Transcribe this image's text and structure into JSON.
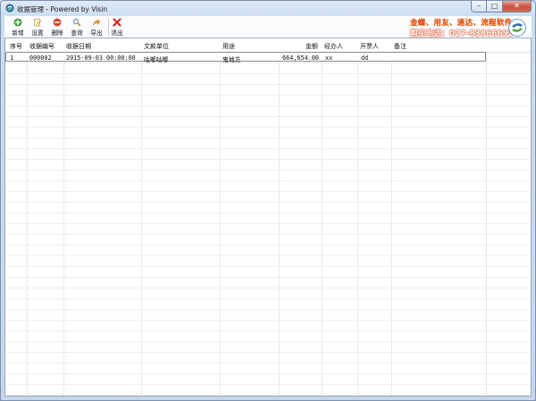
{
  "window": {
    "title": "收据管理 - Powered by Visin",
    "controls": {
      "minimize": "–",
      "maximize": "□",
      "close": "✕"
    }
  },
  "toolbar": {
    "buttons": [
      {
        "label": "新增",
        "icon": "add-icon",
        "color": "#3a9b2e"
      },
      {
        "label": "设置",
        "icon": "edit-icon",
        "color": "#e0a020"
      },
      {
        "label": "删除",
        "icon": "delete-icon",
        "color": "#d9442b"
      },
      {
        "label": "查询",
        "icon": "search-icon",
        "color": "#c9901e"
      },
      {
        "label": "导出",
        "icon": "export-icon",
        "color": "#e39b2a"
      },
      {
        "label": "退出",
        "icon": "exit-icon",
        "color": "#d8241d"
      }
    ]
  },
  "promo": {
    "line1": "金蝶、用友、速达、流程软件",
    "line2": "购买电话：027-83866692"
  },
  "table": {
    "columns": [
      "序号",
      "收据编号",
      "收据日期",
      "文款单位",
      "用途",
      "金额",
      "经办人",
      "开票人",
      "备注"
    ],
    "rows": [
      [
        "1",
        "000002",
        "2015-09-03 00:00:00",
        "咕嘟咕嘟",
        "鬼地方",
        "664,654.00",
        "xx",
        "dd",
        ""
      ]
    ]
  },
  "colors": {
    "accent": "#e23c0b",
    "grid_line": "#eceff2",
    "toolbar_bg": "#fbfcfe"
  }
}
